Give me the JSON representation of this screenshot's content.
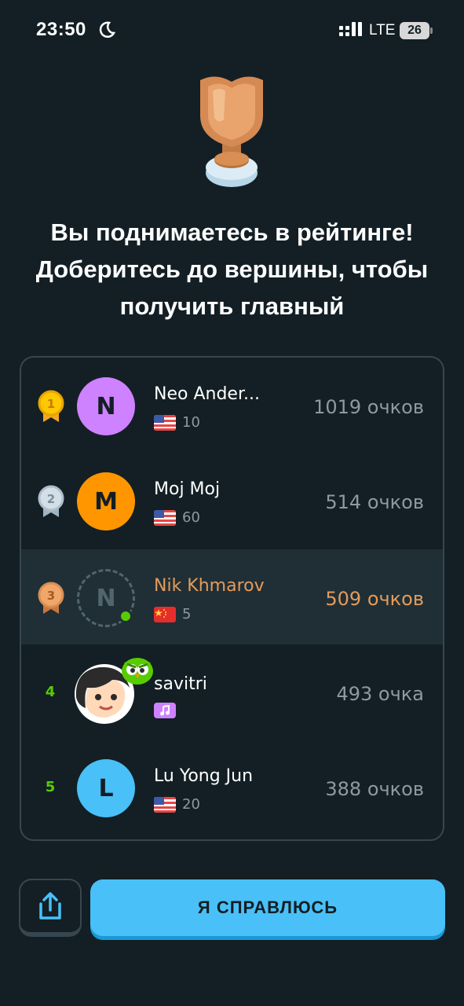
{
  "status_bar": {
    "time": "23:50",
    "network": "LTE",
    "battery": "26"
  },
  "headline": "Вы поднимаетесь в рейтинге! Доберитесь до вершины, чтобы получить главный",
  "leaderboard": [
    {
      "rank": "1",
      "medal": "gold",
      "initial": "N",
      "avatar_color": "#ce82ff",
      "name": "Neo Ander...",
      "badge": "us-flag",
      "sub_value": "10",
      "points": "1019 очков",
      "current_user": false
    },
    {
      "rank": "2",
      "medal": "silver",
      "initial": "M",
      "avatar_color": "#ff9600",
      "name": "Moj Moj",
      "badge": "us-flag",
      "sub_value": "60",
      "points": "514 очков",
      "current_user": false
    },
    {
      "rank": "3",
      "medal": "bronze",
      "initial": "N",
      "avatar_color": "transparent",
      "name": "Nik Khmarov",
      "badge": "cn-flag",
      "sub_value": "5",
      "points": "509 очков",
      "current_user": true
    },
    {
      "rank": "4",
      "medal": "none",
      "initial": "",
      "avatar_color": "#ffffff",
      "name": "savitri",
      "badge": "music-icon",
      "sub_value": "",
      "points": "493 очка",
      "current_user": false
    },
    {
      "rank": "5",
      "medal": "none",
      "initial": "L",
      "avatar_color": "#49c0f8",
      "name": "Lu Yong Jun",
      "badge": "us-flag",
      "sub_value": "20",
      "points": "388 очков",
      "current_user": false
    }
  ],
  "buttons": {
    "share_icon": "share-icon",
    "continue_label": "Я СПРАВЛЮСЬ"
  },
  "colors": {
    "background": "#131f24",
    "accent_blue": "#49c0f8",
    "current_user": "#e49b5b",
    "rank_green": "#58cc02"
  }
}
